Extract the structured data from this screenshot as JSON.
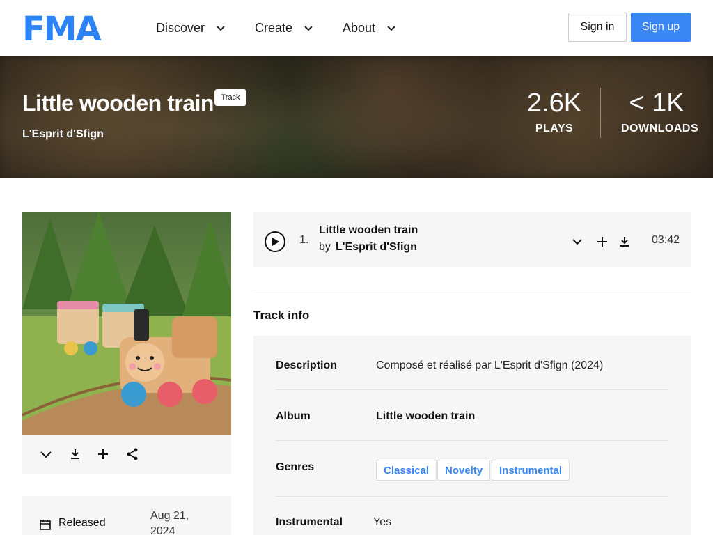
{
  "header": {
    "logo_text": "FMA",
    "nav": [
      {
        "label": "Discover"
      },
      {
        "label": "Create"
      },
      {
        "label": "About"
      }
    ],
    "signin_label": "Sign in",
    "signup_label": "Sign up"
  },
  "hero": {
    "title": "Little wooden train",
    "badge": "Track",
    "artist": "L'Esprit d'Sfign",
    "plays_value": "2.6K",
    "plays_label": "PLAYS",
    "downloads_value": "< 1K",
    "downloads_label": "DOWNLOADS"
  },
  "artwork": {
    "actions": [
      "heart-icon",
      "download-icon",
      "plus-icon",
      "share-icon"
    ]
  },
  "release": {
    "label": "Released",
    "date": "Aug 21, 2024"
  },
  "player": {
    "track_number": "1.",
    "title": "Little wooden train",
    "by": "by",
    "artist": "L'Esprit d'Sfign",
    "duration": "03:42"
  },
  "track_info": {
    "heading": "Track info",
    "description_label": "Description",
    "description_value": "Composé et réalisé par L'Esprit d'Sfign (2024)",
    "album_label": "Album",
    "album_value": "Little wooden train",
    "genres_label": "Genres",
    "genres": [
      "Classical",
      "Novelty",
      "Instrumental"
    ],
    "instrumental_label": "Instrumental",
    "instrumental_value": "Yes"
  },
  "colors": {
    "brand_blue": "#2b83f6",
    "signup_bg": "#3a86f5",
    "panel_bg": "#f6f6f6"
  }
}
